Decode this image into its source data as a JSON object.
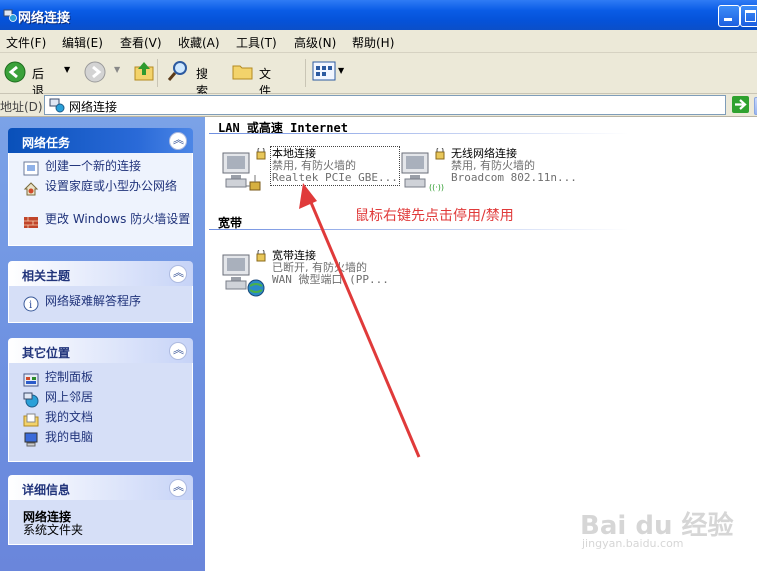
{
  "window": {
    "title": "网络连接"
  },
  "menu": [
    {
      "label": "文件(F)"
    },
    {
      "label": "编辑(E)"
    },
    {
      "label": "查看(V)"
    },
    {
      "label": "收藏(A)"
    },
    {
      "label": "工具(T)"
    },
    {
      "label": "高级(N)"
    },
    {
      "label": "帮助(H)"
    }
  ],
  "toolbar": {
    "back_label": "后退",
    "search_label": "搜索",
    "folders_label": "文件夹"
  },
  "address": {
    "label": "地址(D)",
    "value": "网络连接"
  },
  "sidebar": {
    "network_tasks": {
      "title": "网络任务",
      "items": [
        {
          "label": "创建一个新的连接"
        },
        {
          "label": "设置家庭或小型办公网络"
        },
        {
          "label": "更改 Windows 防火墙设置"
        }
      ]
    },
    "related": {
      "title": "相关主题",
      "items": [
        {
          "label": "网络疑难解答程序"
        }
      ]
    },
    "other_places": {
      "title": "其它位置",
      "items": [
        {
          "label": "控制面板"
        },
        {
          "label": "网上邻居"
        },
        {
          "label": "我的文档"
        },
        {
          "label": "我的电脑"
        }
      ]
    },
    "details": {
      "title": "详细信息",
      "name": "网络连接",
      "type": "系统文件夹"
    }
  },
  "groups": {
    "lan": {
      "title": "LAN 或高速 Internet",
      "connections": [
        {
          "name": "本地连接",
          "status": "禁用, 有防火墙的",
          "device": "Realtek PCIe GBE..."
        },
        {
          "name": "无线网络连接",
          "status": "禁用, 有防火墙的",
          "device": "Broadcom 802.11n..."
        }
      ]
    },
    "broadband": {
      "title": "宽带",
      "connections": [
        {
          "name": "宽带连接",
          "status": "已断开, 有防火墙的",
          "device": "WAN 微型端口 (PP..."
        }
      ]
    }
  },
  "annotation": {
    "text": "鼠标右键先点击停用/禁用",
    "color": "#e03a3a"
  },
  "watermark": {
    "brand": "Bai du 经验",
    "url": "jingyan.baidu.com"
  }
}
